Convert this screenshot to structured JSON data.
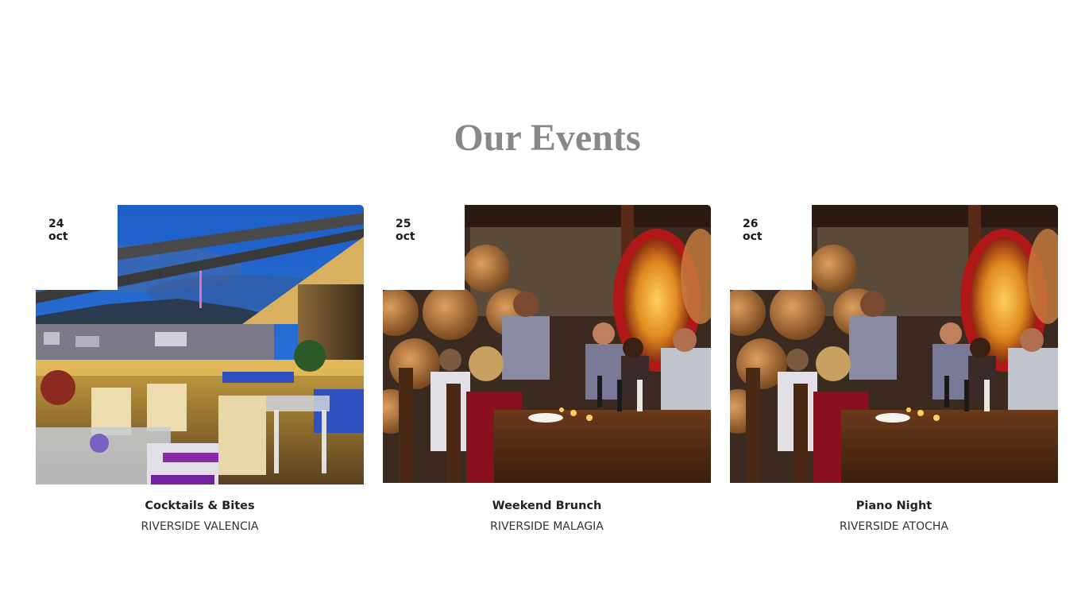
{
  "section": {
    "title": "Our Events"
  },
  "events": [
    {
      "day": "24",
      "month": "oct",
      "title": "Cocktails & Bites",
      "venue": "RIVERSIDE VALENCIA",
      "image": "rooftop-terrace-photo"
    },
    {
      "day": "25",
      "month": "oct",
      "title": "Weekend Brunch",
      "venue": "RIVERSIDE MALAGIA",
      "image": "wine-cellar-dinner-photo"
    },
    {
      "day": "26",
      "month": "oct",
      "title": "Piano Night",
      "venue": "RIVERSIDE ATOCHA",
      "image": "wine-cellar-dinner-photo"
    }
  ]
}
